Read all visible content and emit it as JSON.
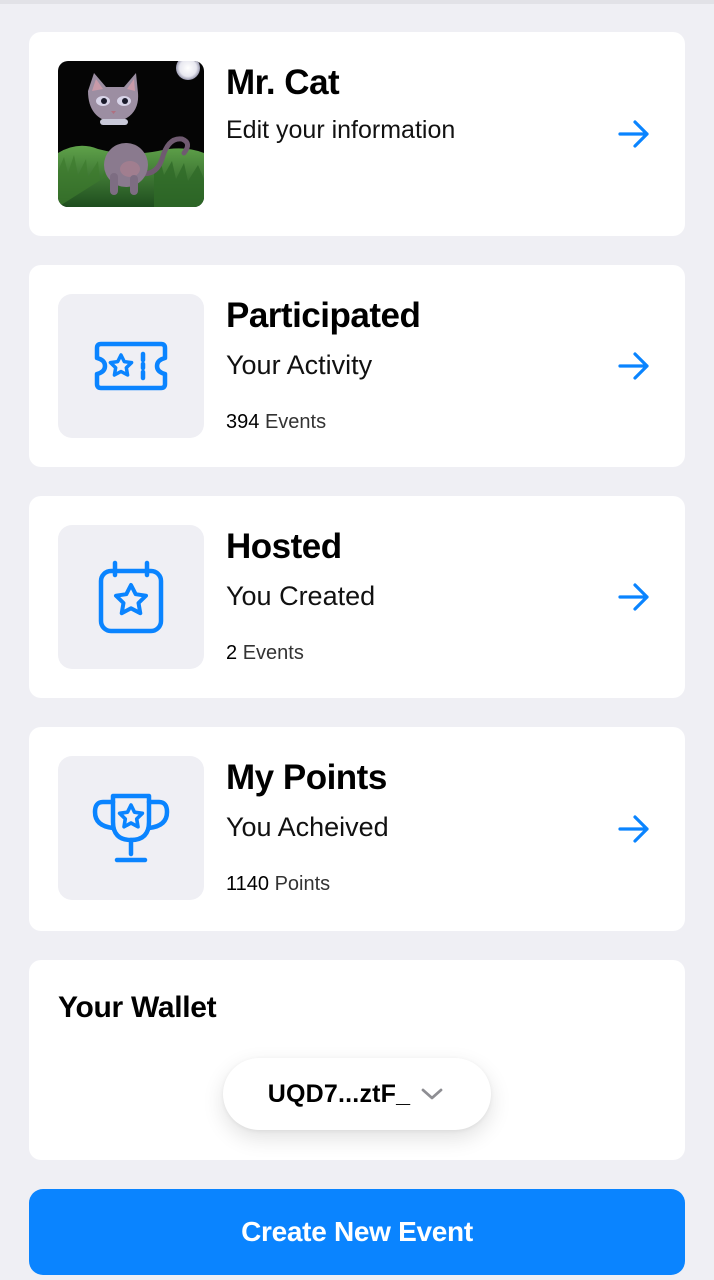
{
  "colors": {
    "accent": "#0a84ff",
    "background": "#efeff4",
    "card": "#ffffff",
    "icon_tile": "#efeff4"
  },
  "profile": {
    "name": "Mr. Cat",
    "subtitle": "Edit your information",
    "avatar": "cat-avatar-image",
    "arrow_icon": "arrow-right-icon"
  },
  "participated": {
    "title": "Participated",
    "subtitle": "Your Activity",
    "count": "394",
    "unit": "Events",
    "icon": "ticket-star-icon",
    "arrow_icon": "arrow-right-icon"
  },
  "hosted": {
    "title": "Hosted",
    "subtitle": "You Created",
    "count": "2",
    "unit": "Events",
    "icon": "calendar-star-icon",
    "arrow_icon": "arrow-right-icon"
  },
  "points": {
    "title": "My Points",
    "subtitle": "You Acheived",
    "count": "1140",
    "unit": "Points",
    "icon": "trophy-star-icon",
    "arrow_icon": "arrow-right-icon"
  },
  "wallet": {
    "title": "Your Wallet",
    "address": "UQD7...ztF_",
    "chevron_icon": "chevron-down-icon"
  },
  "create_button": {
    "label": "Create New Event"
  }
}
